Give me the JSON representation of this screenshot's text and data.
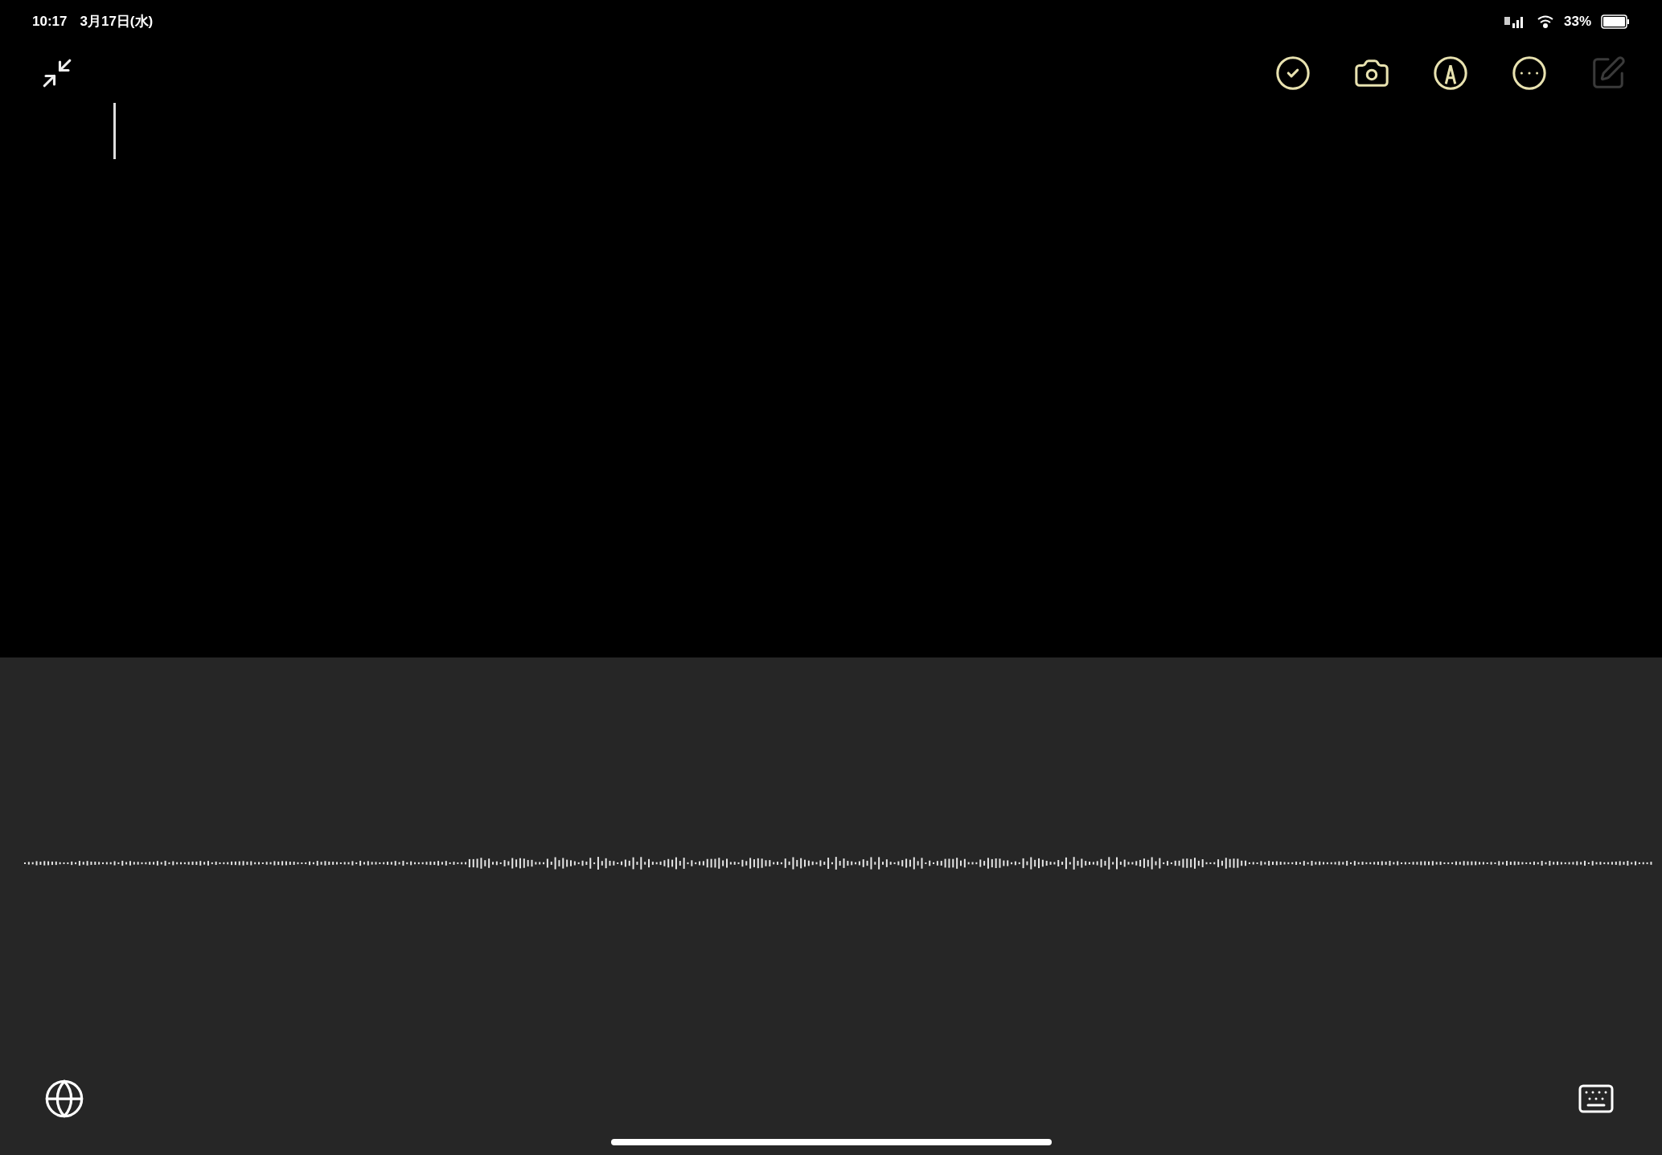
{
  "status_bar": {
    "time": "10:17",
    "date": "3月17日(水)",
    "battery": "33%"
  },
  "toolbar": [
    {
      "kind": "checklist",
      "disabled": false
    },
    {
      "kind": "camera",
      "disabled": false
    },
    {
      "kind": "markup",
      "disabled": false
    },
    {
      "kind": "more",
      "disabled": false
    },
    {
      "kind": "compose",
      "disabled": true
    }
  ]
}
